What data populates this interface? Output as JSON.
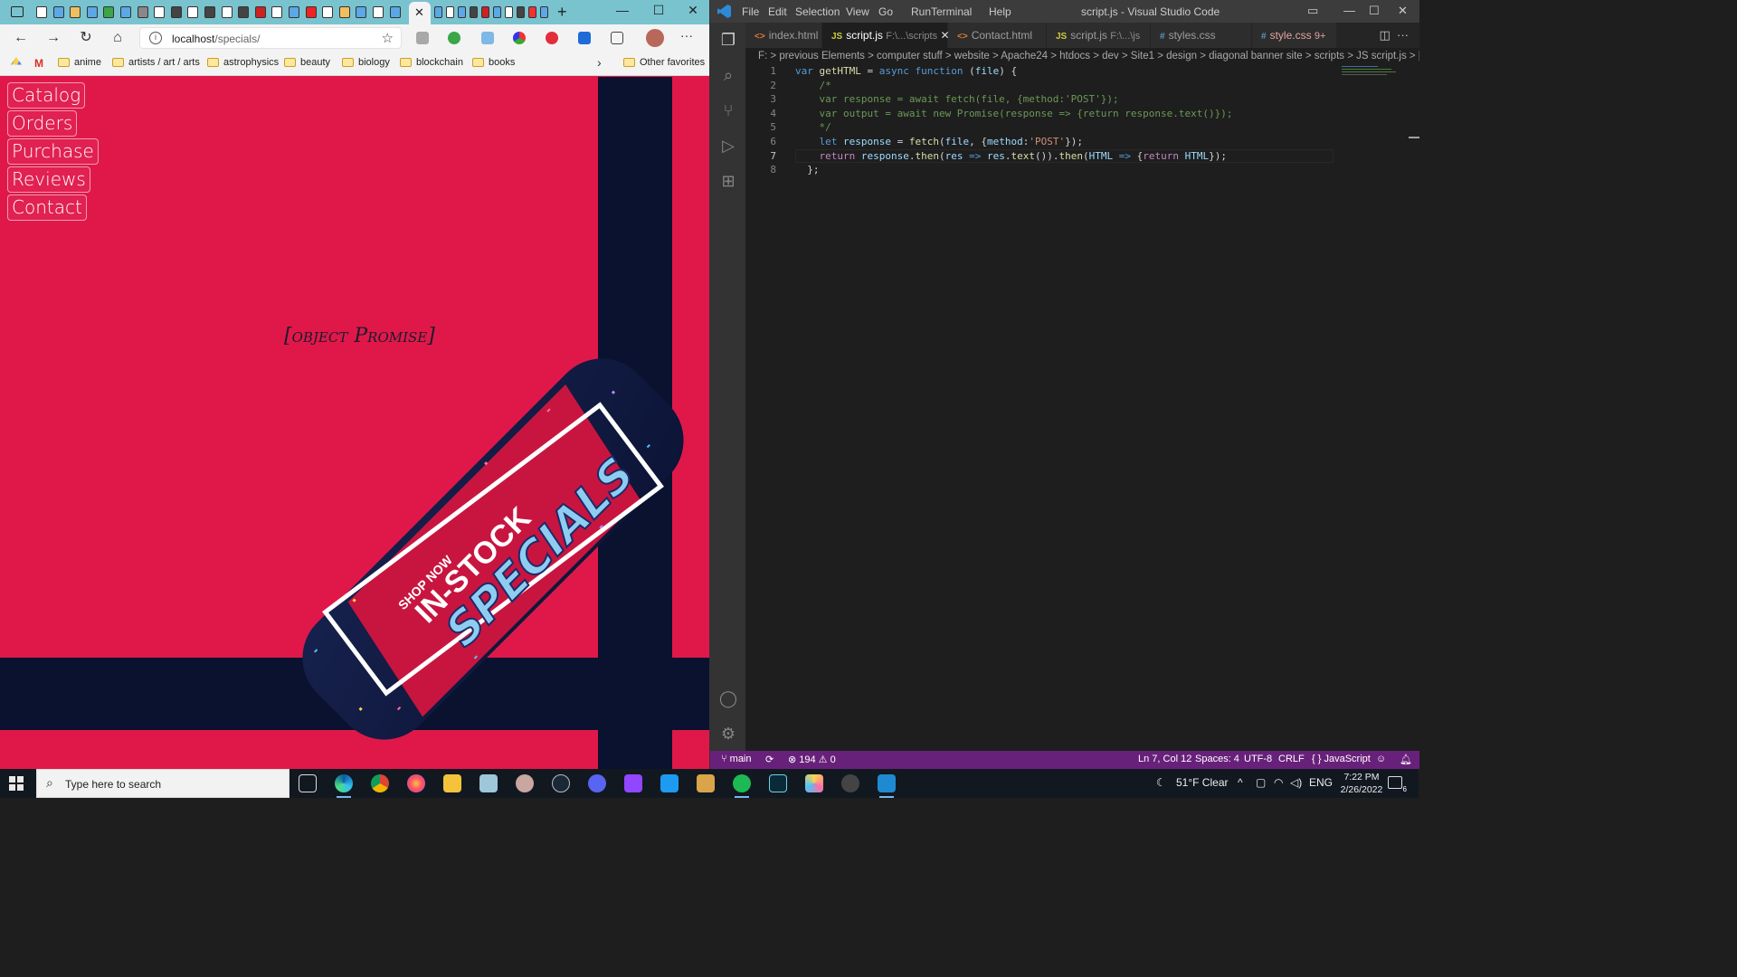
{
  "browser": {
    "url_host": "localhost",
    "url_path": "/specials/",
    "bookmarks": [
      "anime",
      "artists / art / arts",
      "astrophysics",
      "beauty",
      "biology",
      "blockchain",
      "books"
    ],
    "other_favorites": "Other favorites",
    "nav_links": [
      "Catalog",
      "Orders",
      "Purchase",
      "Reviews",
      "Contact"
    ],
    "body_text": "[object Promise]",
    "banner": {
      "shop_now": "SHOP NOW",
      "in_stock": "IN-STOCK",
      "specials": "SPECIALS"
    }
  },
  "vscode": {
    "menu": [
      "File",
      "Edit",
      "Selection",
      "View",
      "Go",
      "Run",
      "Terminal",
      "Help"
    ],
    "title": "script.js - Visual Studio Code",
    "tabs": [
      {
        "icon": "<>",
        "label": "index.html",
        "sub": ""
      },
      {
        "icon": "JS",
        "label": "script.js",
        "sub": "F:\\...\\scripts"
      },
      {
        "icon": "<>",
        "label": "Contact.html",
        "sub": ""
      },
      {
        "icon": "JS",
        "label": "script.js",
        "sub": "F:\\...\\js"
      },
      {
        "icon": "#",
        "label": "styles.css",
        "sub": ""
      },
      {
        "icon": "#",
        "label": "style.css",
        "sub": "9+"
      }
    ],
    "breadcrumb": "F: > previous Elements > computer stuff > website > Apache24 > htdocs > dev > Site1 > design > diagonal banner site > scripts > JS script.js > [@] getHTML",
    "line_numbers": [
      "1",
      "2",
      "3",
      "4",
      "5",
      "6",
      "7",
      "8"
    ],
    "status": {
      "branch": "main",
      "problems": "⊗ 194 ⚠ 0",
      "position": "Ln 7, Col 12",
      "spaces": "Spaces: 4",
      "encoding": "UTF-8",
      "eol": "CRLF",
      "language": "{ } JavaScript"
    }
  },
  "taskbar": {
    "search_placeholder": "Type here to search",
    "weather": "51°F  Clear",
    "language": "ENG",
    "time": "7:22 PM",
    "date": "2/26/2022",
    "notifications": "6"
  },
  "colors": {
    "page_bg": "#e0184a",
    "stripe": "#0a1230",
    "vscode_status": "#68217a",
    "vscode_bg": "#1e1e1e"
  }
}
